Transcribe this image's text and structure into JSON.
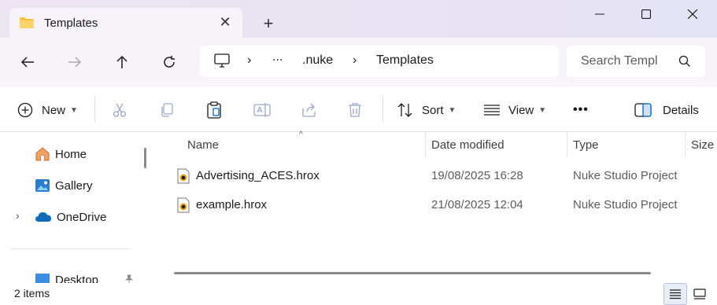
{
  "window": {
    "tab_title": "Templates",
    "tab_icon": "folder-icon",
    "new_tab_symbol": "+",
    "close_symbol": "✕"
  },
  "nav": {
    "breadcrumbs": [
      "...",
      ".nuke",
      "Templates"
    ],
    "search_placeholder": "Search Templ"
  },
  "toolbar": {
    "new_label": "New",
    "sort_label": "Sort",
    "view_label": "View",
    "more_label": "•••",
    "details_label": "Details"
  },
  "sidebar": {
    "items": [
      {
        "label": "Home",
        "icon": "home-icon"
      },
      {
        "label": "Gallery",
        "icon": "gallery-icon"
      },
      {
        "label": "OneDrive",
        "icon": "onedrive-icon"
      },
      {
        "label": "Desktop",
        "icon": "desktop-icon"
      }
    ]
  },
  "columns": [
    "Name",
    "Date modified",
    "Type",
    "Size"
  ],
  "files": [
    {
      "name": "Advertising_ACES.hrox",
      "date": "19/08/2025 16:28",
      "type": "Nuke Studio Project"
    },
    {
      "name": "example.hrox",
      "date": "21/08/2025 12:04",
      "type": "Nuke Studio Project"
    }
  ],
  "status": {
    "item_count": "2 items"
  },
  "colors": {
    "titlebar": "#ece4f1",
    "navbar": "#f6f3f9",
    "accent": "#0067c0",
    "folder": "#f4c23d"
  }
}
